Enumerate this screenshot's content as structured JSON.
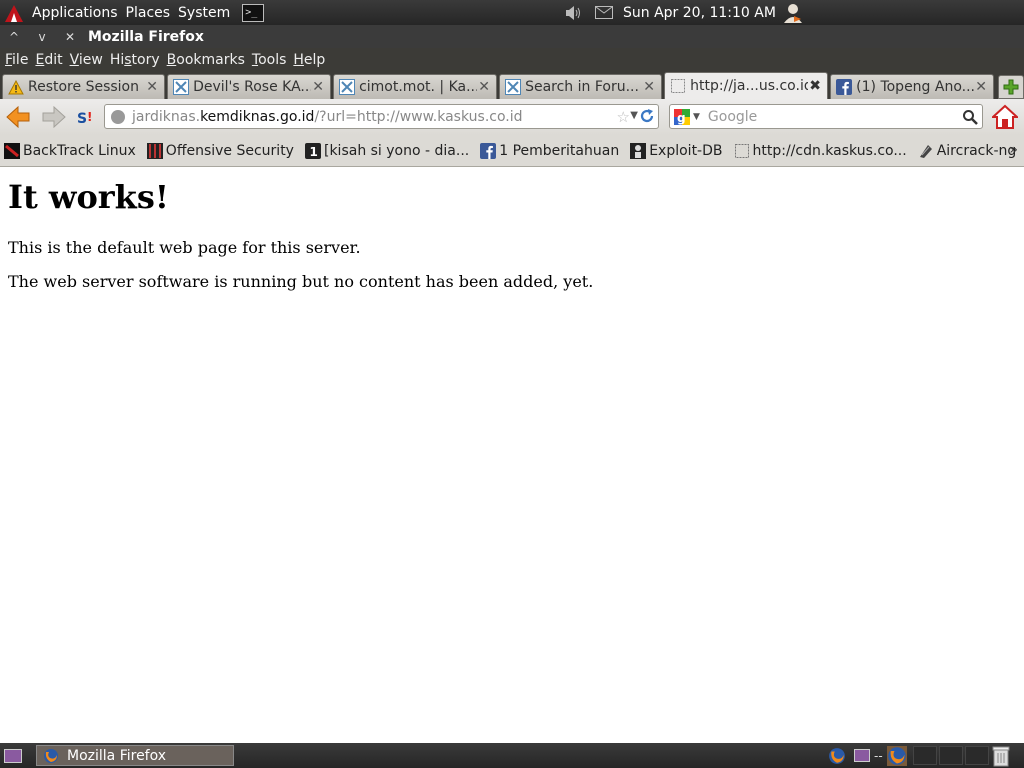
{
  "top_panel": {
    "menus": [
      "Applications",
      "Places",
      "System"
    ],
    "clock": "Sun Apr 20, 11:10 AM"
  },
  "window": {
    "title": "Mozilla Firefox"
  },
  "menubar": {
    "items": [
      {
        "u": "F",
        "rest": "ile"
      },
      {
        "u": "E",
        "rest": "dit"
      },
      {
        "u": "V",
        "rest": "iew"
      },
      {
        "pre": "Hi",
        "u": "s",
        "rest": "tory"
      },
      {
        "u": "B",
        "rest": "ookmarks"
      },
      {
        "u": "T",
        "rest": "ools"
      },
      {
        "u": "H",
        "rest": "elp"
      }
    ]
  },
  "tabs": [
    {
      "label": "Restore Session",
      "icon": "warning-icon",
      "active": false
    },
    {
      "label": "Devil's Rose KA...",
      "icon": "kaskus-icon",
      "active": false
    },
    {
      "label": "cimot.mot. | Ka...",
      "icon": "kaskus-icon",
      "active": false
    },
    {
      "label": "Search in Foru...",
      "icon": "kaskus-icon",
      "active": false
    },
    {
      "label": "http://ja...us.co.id",
      "icon": "blank-page-icon",
      "active": true
    },
    {
      "label": "(1) Topeng Ano...",
      "icon": "facebook-icon",
      "active": false
    }
  ],
  "urlbar": {
    "prefix": "jardiknas.",
    "host": "kemdiknas.go.id",
    "suffix": "/?url=http://www.kaskus.co.id"
  },
  "search": {
    "placeholder": "Google"
  },
  "bookmarks": [
    {
      "label": "BackTrack Linux",
      "icon": "backtrack-icon"
    },
    {
      "label": "Offensive Security",
      "icon": "offsec-icon"
    },
    {
      "label": "[kisah si yono - dia...",
      "icon": "numbered-1-icon"
    },
    {
      "label": "1 Pemberitahuan",
      "icon": "facebook-icon"
    },
    {
      "label": "Exploit-DB",
      "icon": "exploitdb-icon"
    },
    {
      "label": "http://cdn.kaskus.co...",
      "icon": "blank-page-icon"
    },
    {
      "label": "Aircrack-ng",
      "icon": "aircrack-icon"
    }
  ],
  "page": {
    "heading": "It works!",
    "paragraph1": "This is the default web page for this server.",
    "paragraph2": "The web server software is running but no content has been added, yet."
  },
  "taskbar": {
    "window_label": "Mozilla Firefox"
  },
  "bottom_tray": {
    "separator": "--"
  }
}
